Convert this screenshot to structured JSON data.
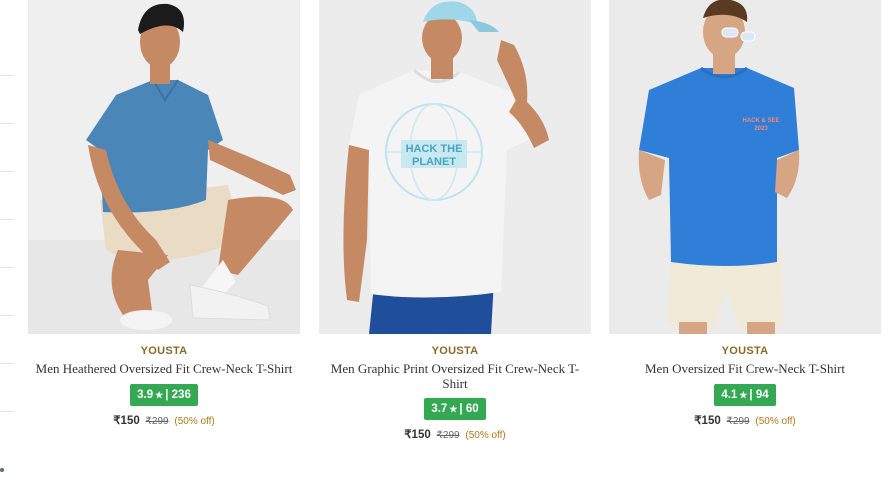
{
  "products": [
    {
      "brand": "YOUSTA",
      "name": "Men Heathered Oversized Fit Crew-Neck T-Shirt",
      "rating": "3.9",
      "star": "★",
      "rating_sep": "|",
      "reviews": "236",
      "price": "₹150",
      "mrp": "₹299",
      "discount": "(50% off)",
      "shirt_color": "#4a86b8"
    },
    {
      "brand": "YOUSTA",
      "name": "Men Graphic Print Oversized Fit Crew-Neck T-Shirt",
      "rating": "3.7",
      "star": "★",
      "rating_sep": "|",
      "reviews": "60",
      "price": "₹150",
      "mrp": "₹299",
      "discount": "(50% off)",
      "shirt_color": "#f4f4f4",
      "print_text": "HACK THE PLANET"
    },
    {
      "brand": "YOUSTA",
      "name": "Men Oversized Fit Crew-Neck T-Shirt",
      "rating": "4.1",
      "star": "★",
      "rating_sep": "|",
      "reviews": "94",
      "price": "₹150",
      "mrp": "₹299",
      "discount": "(50% off)",
      "shirt_color": "#2f7fd8"
    }
  ],
  "colors": {
    "brand": "#8a6a2a",
    "rating_bg": "#34a853",
    "discount": "#b07a1a"
  }
}
